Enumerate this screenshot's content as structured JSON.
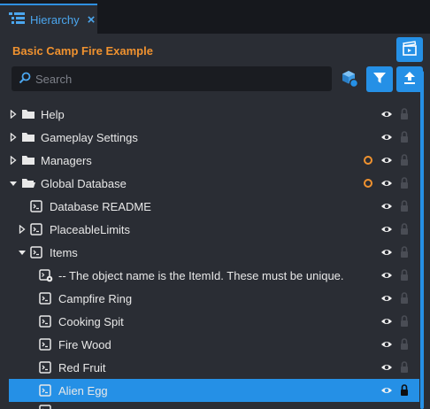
{
  "tab": {
    "title": "Hierarchy",
    "close": "×"
  },
  "project_title": "Basic Camp Fire Example",
  "search": {
    "placeholder": "Search",
    "value": ""
  },
  "colors": {
    "accent": "#2590e6",
    "title": "#f0922f",
    "modified_dot": "#f0922f"
  },
  "tree": [
    {
      "label": "Help",
      "type": "folder",
      "arrow": "collapsed",
      "modified": false
    },
    {
      "label": "Gameplay Settings",
      "type": "folder",
      "arrow": "collapsed",
      "modified": false
    },
    {
      "label": "Managers",
      "type": "folder",
      "arrow": "collapsed",
      "modified": true
    },
    {
      "label": "Global Database",
      "type": "folder-open",
      "arrow": "expanded",
      "modified": true
    },
    {
      "label": "Database README",
      "type": "script",
      "arrow": "none",
      "modified": false
    },
    {
      "label": "PlaceableLimits",
      "type": "script",
      "arrow": "collapsed",
      "modified": false
    },
    {
      "label": "Items",
      "type": "script",
      "arrow": "expanded",
      "modified": false
    },
    {
      "label": "-- The object name is the ItemId. These must be unique.",
      "type": "script-gear",
      "arrow": "none",
      "modified": false
    },
    {
      "label": "Campfire Ring",
      "type": "script",
      "arrow": "none",
      "modified": false
    },
    {
      "label": "Cooking Spit",
      "type": "script",
      "arrow": "none",
      "modified": false
    },
    {
      "label": "Fire Wood",
      "type": "script",
      "arrow": "none",
      "modified": false
    },
    {
      "label": "Red Fruit",
      "type": "script",
      "arrow": "none",
      "modified": false
    },
    {
      "label": "Alien Egg",
      "type": "script",
      "arrow": "none",
      "modified": false,
      "selected": true
    }
  ]
}
